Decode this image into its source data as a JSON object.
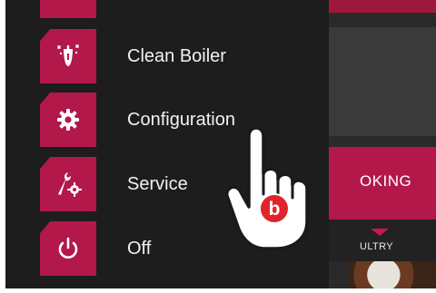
{
  "menu": {
    "items": [
      {
        "label": "",
        "icon": "unknown-icon"
      },
      {
        "label": "Clean Boiler",
        "icon": "boiler-clean-icon"
      },
      {
        "label": "Configuration",
        "icon": "gear-icon"
      },
      {
        "label": "Service",
        "icon": "wrench-gear-icon"
      },
      {
        "label": "Off",
        "icon": "power-icon"
      }
    ]
  },
  "background": {
    "cooking_label": "OKING",
    "tab_label": "ULTRY"
  },
  "pointer": {
    "badge": "b",
    "icon": "hand-pointer-icon"
  },
  "colors": {
    "accent": "#b3184a",
    "panel": "#1d1d1d",
    "text": "#f2f2f2"
  }
}
